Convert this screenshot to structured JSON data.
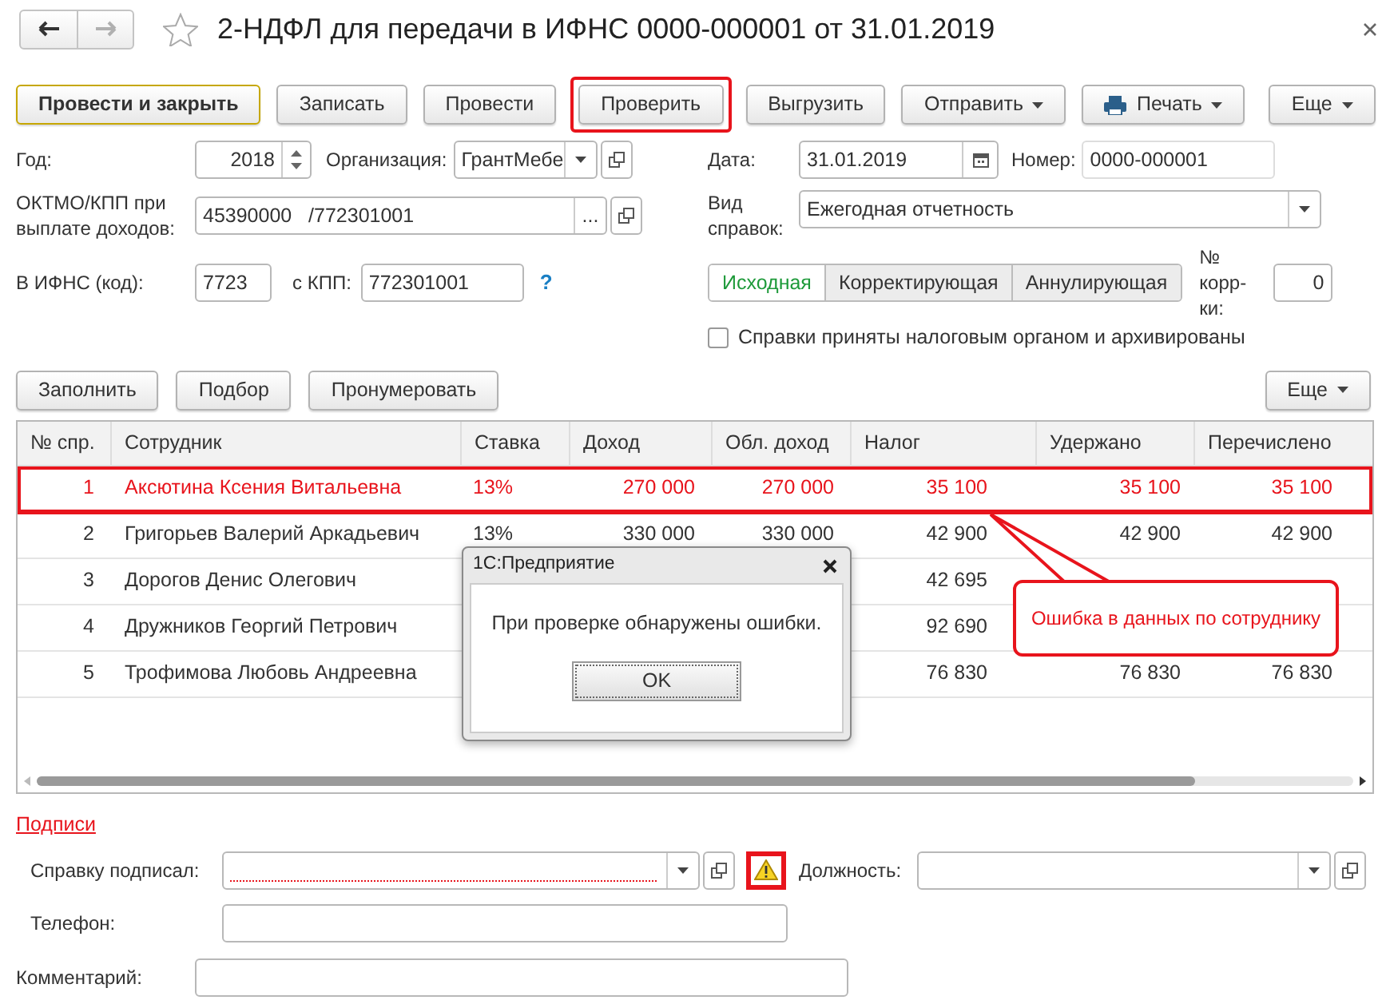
{
  "window": {
    "title": "2-НДФЛ для передачи в ИФНС 0000-000001 от 31.01.2019",
    "starred": false
  },
  "nav_buttons": [
    {
      "kind": "back",
      "disabled": false
    },
    {
      "kind": "forward",
      "disabled": true
    }
  ],
  "toolbar": [
    {
      "label": "Провести и закрыть",
      "kind": "default",
      "highlighted": false
    },
    {
      "label": "Записать",
      "kind": "button",
      "highlighted": false
    },
    {
      "label": "Провести",
      "kind": "button",
      "highlighted": false
    },
    {
      "label": "Проверить",
      "kind": "button",
      "highlighted": true
    },
    {
      "label": "Выгрузить",
      "kind": "button",
      "highlighted": false
    },
    {
      "label": "Отправить",
      "kind": "dropdown",
      "highlighted": false
    },
    {
      "label": "Печать",
      "kind": "print",
      "highlighted": false
    },
    {
      "label": "Еще",
      "kind": "more",
      "highlighted": false
    }
  ],
  "header": {
    "year": {
      "label": "Год:",
      "value": "2018"
    },
    "organization": {
      "label": "Организация:",
      "value": "ГрантМебе"
    },
    "date": {
      "label": "Дата:",
      "value": "31.01.2019"
    },
    "number": {
      "label": "Номер:",
      "value": "0000-000001"
    },
    "oktmo": {
      "label": "ОКТМО/КПП при выплате доходов:",
      "value": "45390000   /772301001",
      "button": "..."
    },
    "report_type": {
      "label": "Вид справок:",
      "value": "Ежегодная отчетность"
    },
    "ifns": {
      "label": "В ИФНС (код):",
      "value": "7723"
    },
    "kpp": {
      "label": "с КПП:",
      "value": "772301001"
    },
    "help": "?",
    "correction_types": [
      {
        "label": "Исходная",
        "selected": true
      },
      {
        "label": "Корректирующая",
        "selected": false
      },
      {
        "label": "Аннулирующая",
        "selected": false
      }
    ],
    "correction_number": {
      "label": "№ корр-ки:",
      "value": "0"
    },
    "archived": {
      "label": "Справки приняты налоговым органом и архивированы",
      "checked": false
    }
  },
  "table_toolbar": [
    {
      "label": "Заполнить",
      "kind": "button"
    },
    {
      "label": "Подбор",
      "kind": "button"
    },
    {
      "label": "Пронумеровать",
      "kind": "button"
    },
    {
      "label": "Еще",
      "kind": "more"
    }
  ],
  "table": {
    "columns": [
      "№ спр.",
      "Сотрудник",
      "Ставка",
      "Доход",
      "Обл. доход",
      "Налог",
      "Удержано",
      "Перечислено"
    ],
    "rows": [
      {
        "cells": [
          "1",
          "Аксютина Ксения Витальевна",
          "13%",
          "270 000",
          "270 000",
          "35 100",
          "35 100",
          "35 100"
        ],
        "error": true,
        "highlighted": true
      },
      {
        "cells": [
          "2",
          "Григорьев Валерий Аркадьевич",
          "13%",
          "330 000",
          "330 000",
          "42 900",
          "42 900",
          "42 900"
        ],
        "error": false,
        "highlighted": false
      },
      {
        "cells": [
          "3",
          "Дорогов Денис Олегович",
          null,
          null,
          null,
          "42 695",
          null,
          null
        ],
        "error": false,
        "highlighted": false
      },
      {
        "cells": [
          "4",
          "Дружников Георгий Петрович",
          null,
          null,
          null,
          "92 690",
          null,
          null
        ],
        "error": false,
        "highlighted": false
      },
      {
        "cells": [
          "5",
          "Трофимова Любовь Андреевна",
          null,
          null,
          null,
          "76 830",
          "76 830",
          "76 830"
        ],
        "error": false,
        "highlighted": false
      }
    ]
  },
  "signatures": {
    "link": "Подписи",
    "signer": {
      "label": "Справку подписал:",
      "invalid": true,
      "warning_highlighted": true
    },
    "position": {
      "label": "Должность:"
    },
    "phone": {
      "label": "Телефон:"
    },
    "comment": {
      "label": "Комментарий:"
    }
  },
  "dialog": {
    "title": "1С:Предприятие",
    "message": "При проверке обнаружены ошибки.",
    "button": "OK"
  },
  "callout": {
    "text": "Ошибка в данных по сотруднику"
  }
}
